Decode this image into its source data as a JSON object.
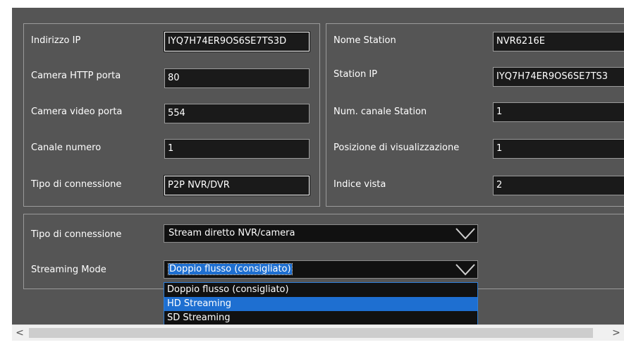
{
  "left_group": {
    "rows": [
      {
        "label": "Indirizzo IP",
        "value": "IYQ7H74ER9OS6SE7TS3D"
      },
      {
        "label": "Camera HTTP porta",
        "value": "80"
      },
      {
        "label": "Camera video porta",
        "value": "554"
      },
      {
        "label": "Canale numero",
        "value": "1"
      },
      {
        "label": "Tipo di connessione",
        "value": "P2P NVR/DVR"
      }
    ]
  },
  "right_group": {
    "rows": [
      {
        "label": "Nome Station",
        "value": "NVR6216E"
      },
      {
        "label": "Station IP",
        "value": "IYQ7H74ER9OS6SE7TS3"
      },
      {
        "label": "Num. canale Station",
        "value": "1"
      },
      {
        "label": "Posizione di visualizzazione",
        "value": "1"
      },
      {
        "label": "Indice vista",
        "value": "2"
      }
    ]
  },
  "stream_group": {
    "connection_label": "Tipo di connessione",
    "connection_value": "Stream diretto NVR/camera",
    "mode_label": "Streaming Mode",
    "mode_value": "Doppio flusso (consigliato)",
    "options": [
      "Doppio flusso (consigliato)",
      "HD Streaming",
      "SD Streaming"
    ],
    "highlighted_option_index": 1
  },
  "scrollbar": {
    "left_arrow": "<",
    "right_arrow": ">"
  },
  "colors": {
    "panel": "#555555",
    "field": "#1a1a1a",
    "accent": "#1e6fd1"
  }
}
